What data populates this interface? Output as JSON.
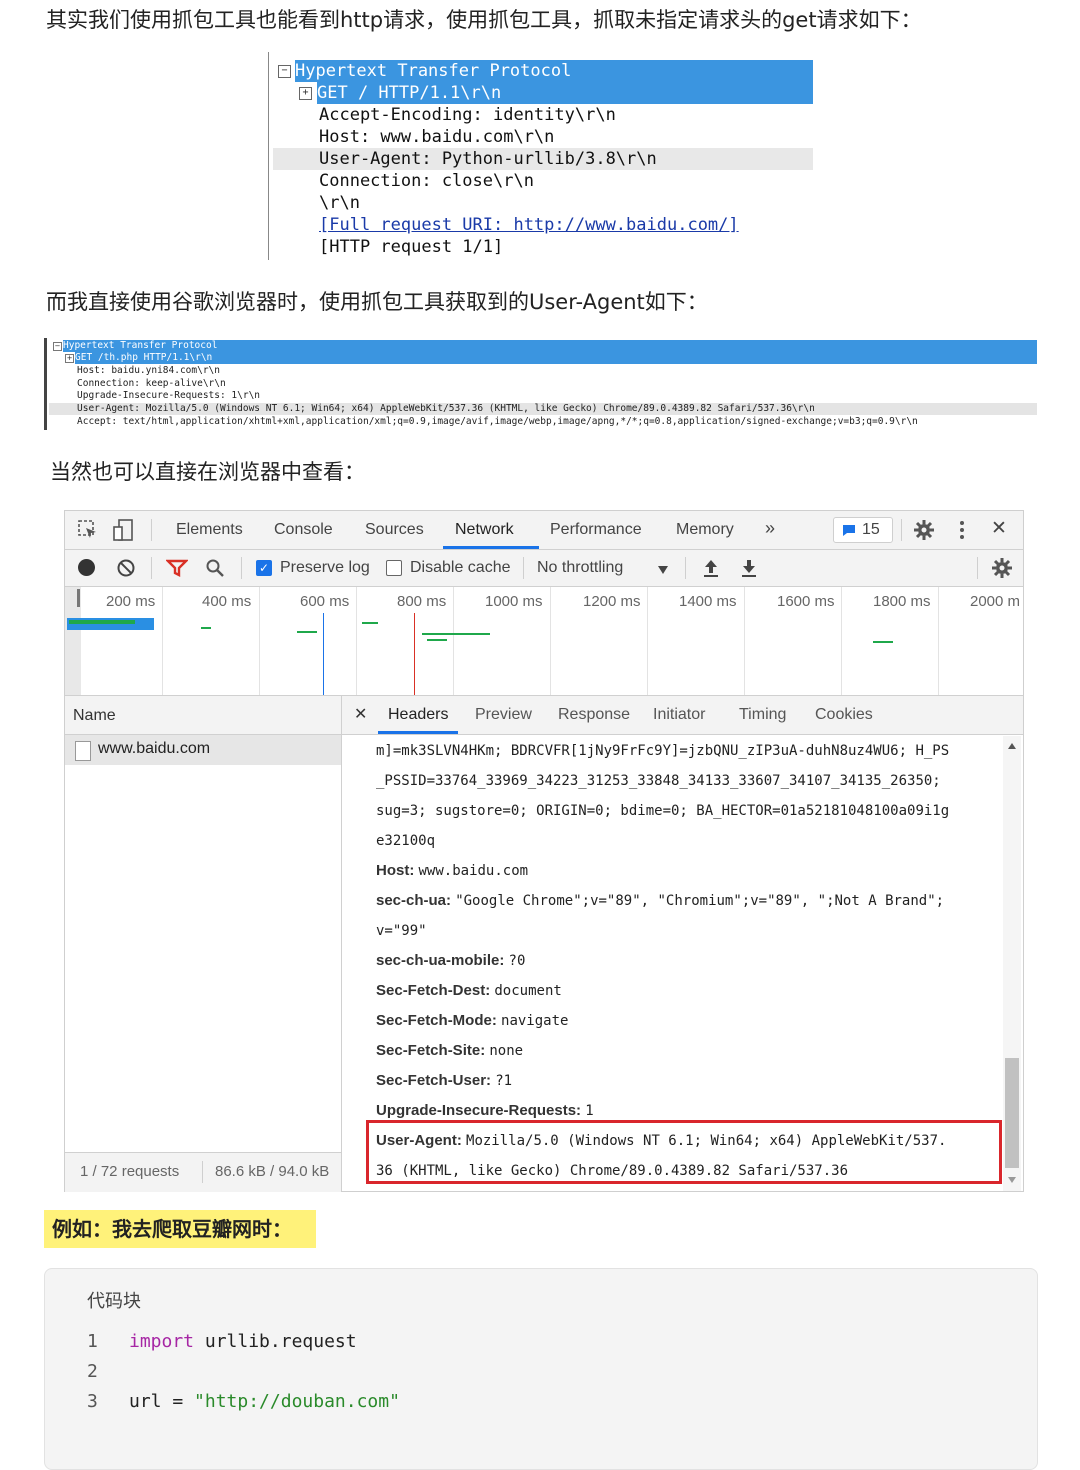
{
  "intro_text": "其实我们使用抓包工具也能看到http请求，使用抓包工具，抓取未指定请求头的get请求如下：",
  "ws1": {
    "rows": [
      "Hypertext Transfer Protocol",
      "GET / HTTP/1.1\\r\\n",
      "Accept-Encoding: identity\\r\\n",
      "Host: www.baidu.com\\r\\n",
      "User-Agent: Python-urllib/3.8\\r\\n",
      "Connection: close\\r\\n",
      "\\r\\n",
      "[Full request URI: http://www.baidu.com/]",
      "[HTTP request 1/1]"
    ],
    "collapse_symbol": "⊟",
    "expand_symbol": "⊞"
  },
  "text2": "而我直接使用谷歌浏览器时，使用抓包工具获取到的User-Agent如下：",
  "ws2": {
    "rows": [
      "Hypertext Transfer Protocol",
      "GET /th.php HTTP/1.1\\r\\n",
      "Host: baidu.yni84.com\\r\\n",
      "Connection: keep-alive\\r\\n",
      "Upgrade-Insecure-Requests: 1\\r\\n",
      "User-Agent: Mozilla/5.0 (Windows NT 6.1; Win64; x64) AppleWebKit/537.36 (KHTML, like Gecko) Chrome/89.0.4389.82 Safari/537.36\\r\\n",
      "Accept: text/html,application/xhtml+xml,application/xml;q=0.9,image/avif,image/webp,image/apng,*/*;q=0.8,application/signed-exchange;v=b3;q=0.9\\r\\n"
    ]
  },
  "text3": "当然也可以直接在浏览器中查看：",
  "devtools": {
    "tabs": [
      "Elements",
      "Console",
      "Sources",
      "Network",
      "Performance",
      "Memory"
    ],
    "more": "»",
    "message_count": "15",
    "close": "✕",
    "toolbar": {
      "preserve_log": "Preserve log",
      "disable_cache": "Disable cache",
      "throttling": "No throttling",
      "preserve_log_checked": true,
      "disable_cache_checked": false
    },
    "timeline_ticks": [
      "200 ms",
      "400 ms",
      "600 ms",
      "800 ms",
      "1000 ms",
      "1200 ms",
      "1400 ms",
      "1600 ms",
      "1800 ms",
      "2000 m"
    ],
    "name_header": "Name",
    "requests": [
      "www.baidu.com"
    ],
    "status": {
      "requests": "1 / 72 requests",
      "size": "86.6 kB / 94.0 kB"
    },
    "detail_tabs": [
      "Headers",
      "Preview",
      "Response",
      "Initiator",
      "Timing",
      "Cookies"
    ],
    "detail_close": "✕",
    "headers": [
      {
        "name": "",
        "value": "m]=mk3SLVN4HKm; BDRCVFR[1jNy9FrFc9Y]=jzbQNU_zIP3uA-duhN8uz4WU6; H_PS"
      },
      {
        "name": "",
        "value": "_PSSID=33764_33969_34223_31253_33848_34133_33607_34107_34135_26350;"
      },
      {
        "name": "",
        "value": "sug=3; sugstore=0; ORIGIN=0; bdime=0; BA_HECTOR=01a52181048100a09i1g"
      },
      {
        "name": "",
        "value": "e32100q"
      },
      {
        "name": "Host:",
        "value": "www.baidu.com"
      },
      {
        "name": "sec-ch-ua:",
        "value": "\"Google Chrome\";v=\"89\", \"Chromium\";v=\"89\", \";Not A Brand\";"
      },
      {
        "name": "",
        "value": "v=\"99\""
      },
      {
        "name": "sec-ch-ua-mobile:",
        "value": "?0"
      },
      {
        "name": "Sec-Fetch-Dest:",
        "value": "document"
      },
      {
        "name": "Sec-Fetch-Mode:",
        "value": "navigate"
      },
      {
        "name": "Sec-Fetch-Site:",
        "value": "none"
      },
      {
        "name": "Sec-Fetch-User:",
        "value": "?1"
      },
      {
        "name": "Upgrade-Insecure-Requests:",
        "value": "1"
      },
      {
        "name": "User-Agent:",
        "value": "Mozilla/5.0 (Windows NT 6.1; Win64; x64) AppleWebKit/537."
      },
      {
        "name": "",
        "value": "36 (KHTML, like Gecko) Chrome/89.0.4389.82 Safari/537.36"
      }
    ],
    "highlight_color": "#d9262c",
    "accent": "#1a73e8"
  },
  "example_label": "例如：我去爬取豆瓣网时：",
  "codeblock": {
    "title": "代码块",
    "lines": [
      {
        "no": "1",
        "parts": [
          {
            "t": "import",
            "c": "kw"
          },
          {
            "t": " urllib.request",
            "c": ""
          }
        ]
      },
      {
        "no": "2",
        "parts": []
      },
      {
        "no": "3",
        "parts": [
          {
            "t": "url = ",
            "c": ""
          },
          {
            "t": "\"http://douban.com\"",
            "c": "str"
          }
        ]
      }
    ]
  }
}
